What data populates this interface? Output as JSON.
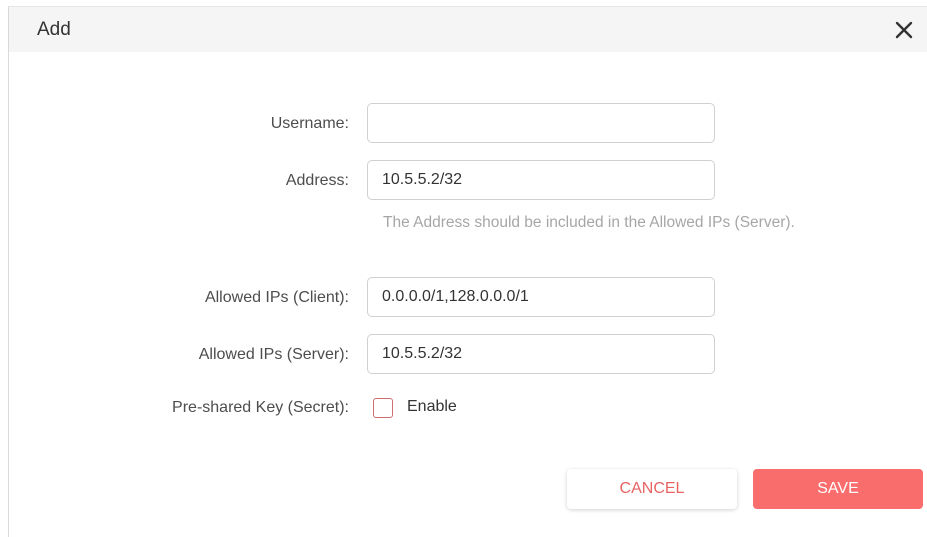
{
  "dialog": {
    "title": "Add",
    "close_icon": "close-icon"
  },
  "form": {
    "username": {
      "label": "Username:",
      "value": ""
    },
    "address": {
      "label": "Address:",
      "value": "10.5.5.2/32",
      "hint": "The Address should be included in the Allowed IPs (Server)."
    },
    "allowed_ips_client": {
      "label": "Allowed IPs (Client):",
      "value": "0.0.0.0/1,128.0.0.0/1"
    },
    "allowed_ips_server": {
      "label": "Allowed IPs (Server):",
      "value": "10.5.5.2/32"
    },
    "preshared_key": {
      "label": "Pre-shared Key (Secret):",
      "checkbox_label": "Enable",
      "checked": false
    }
  },
  "buttons": {
    "cancel_label": "CANCEL",
    "save_label": "SAVE"
  },
  "colors": {
    "accent": "#fa6d6d",
    "cancel_text": "#e86363",
    "header_bg": "#f5f5f5",
    "checkbox_border": "#cf6e6e"
  }
}
